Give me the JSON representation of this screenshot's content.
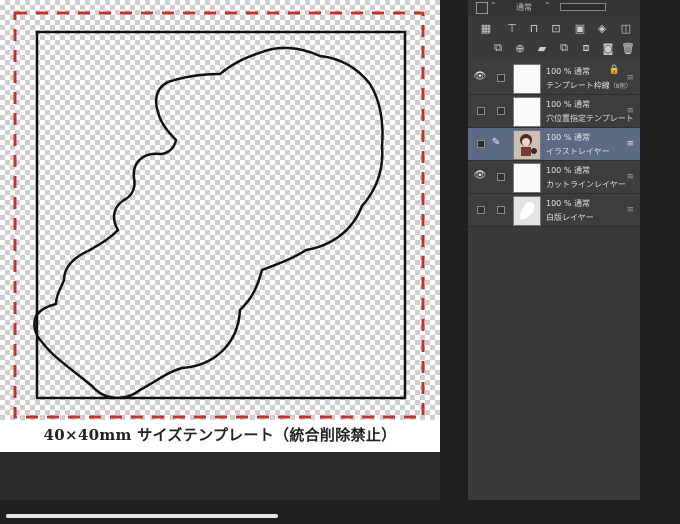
{
  "canvas": {
    "caption": "40×40mm サイズテンプレート（統合削除禁止）",
    "colors": {
      "bleed_dash": "#c8302c",
      "cut_frame": "#111111",
      "outline": "#111111"
    }
  },
  "panel": {
    "blend_mode": "通常",
    "layers": [
      {
        "opacity": "100 %",
        "mode": "通常",
        "name": "テンプレート枠線",
        "note": "（8削）",
        "visible": true,
        "locked": true,
        "active": false
      },
      {
        "opacity": "100 %",
        "mode": "通常",
        "name": "穴位置指定テンプレート",
        "note": "",
        "visible": false,
        "locked": false,
        "active": false
      },
      {
        "opacity": "100 %",
        "mode": "通常",
        "name": "イラストレイヤー",
        "note": "",
        "visible": false,
        "locked": false,
        "active": true
      },
      {
        "opacity": "100 %",
        "mode": "通常",
        "name": "カットラインレイヤー",
        "note": "",
        "visible": true,
        "locked": false,
        "active": false
      },
      {
        "opacity": "100 %",
        "mode": "通常",
        "name": "白版レイヤー",
        "note": "",
        "visible": false,
        "locked": false,
        "active": false
      }
    ]
  },
  "icons": {
    "visible": "eye-icon",
    "edit": "pencil-icon",
    "lock": "lock-icon",
    "handle": "drag-handle-icon"
  }
}
